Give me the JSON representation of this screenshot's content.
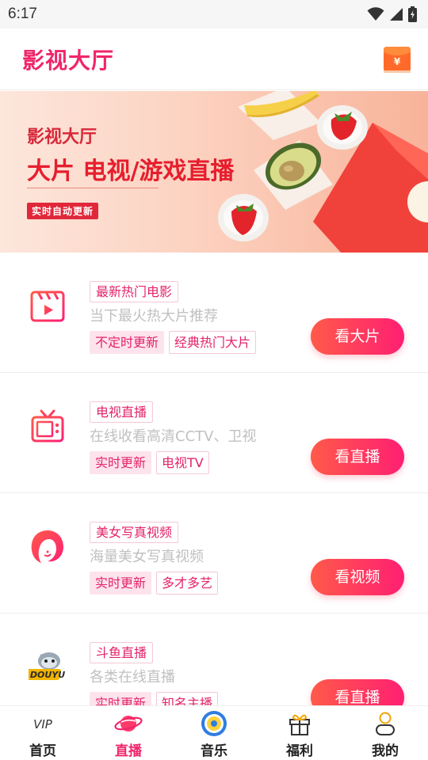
{
  "status_bar": {
    "time": "6:17"
  },
  "header": {
    "title": "影视大厅",
    "redpacket_icon": "red-envelope-icon",
    "redpacket_symbol": "¥"
  },
  "banner": {
    "line1": "影视大厅",
    "line2": "大片 电视/游戏直播",
    "badge": "实时自动更新"
  },
  "colors": {
    "brand": "#f0256b",
    "button_start": "#ff5a4a",
    "button_end": "#ff1f72",
    "tag_bg": "#fde3ec"
  },
  "items": [
    {
      "icon": "film-clapper-icon",
      "title": "最新热门电影",
      "subtitle": "当下最火热大片推荐",
      "tags": [
        "不定时更新",
        "经典热门大片"
      ],
      "button": "看大片"
    },
    {
      "icon": "tv-icon",
      "title": "电视直播",
      "subtitle": "在线收看高清CCTV、卫视",
      "tags": [
        "实时更新",
        "电视TV"
      ],
      "button": "看直播"
    },
    {
      "icon": "woman-face-icon",
      "title": "美女写真视频",
      "subtitle": "海量美女写真视频",
      "tags": [
        "实时更新",
        "多才多艺"
      ],
      "button": "看视频"
    },
    {
      "icon": "douyu-logo-icon",
      "logo_text": "DOUYU",
      "title": "斗鱼直播",
      "subtitle": "各类在线直播",
      "tags": [
        "实时更新",
        "知名主播"
      ],
      "button": "看直播"
    }
  ],
  "nav": [
    {
      "label": "首页",
      "icon": "vip-icon",
      "icon_text": "VIP",
      "active": false
    },
    {
      "label": "直播",
      "icon": "planet-icon",
      "active": true
    },
    {
      "label": "音乐",
      "icon": "music-disc-icon",
      "active": false
    },
    {
      "label": "福利",
      "icon": "gift-icon",
      "active": false
    },
    {
      "label": "我的",
      "icon": "user-icon",
      "active": false
    }
  ]
}
